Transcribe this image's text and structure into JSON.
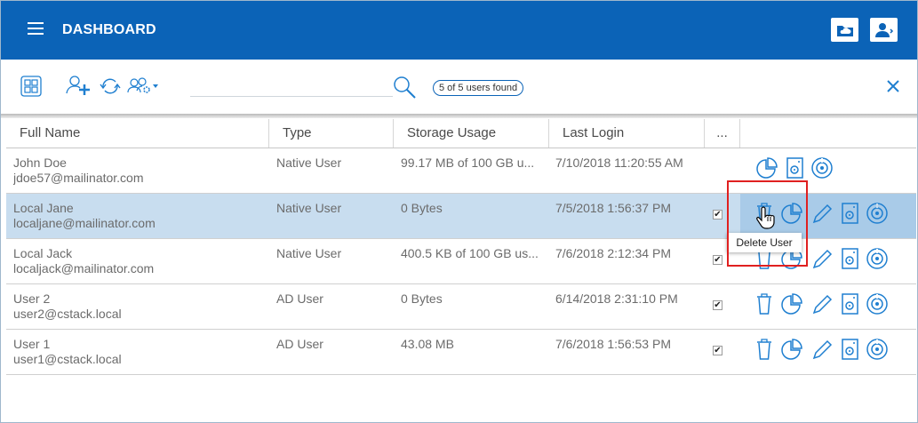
{
  "header": {
    "title": "DASHBOARD"
  },
  "toolbar": {
    "search_placeholder": "",
    "found_text": "5 of 5 users found"
  },
  "table": {
    "columns": [
      "Full Name",
      "Type",
      "Storage Usage",
      "Last Login",
      "..."
    ],
    "rows": [
      {
        "name": "John Doe",
        "email": "jdoe57@mailinator.com",
        "type": "Native User",
        "storage": "99.17 MB of 100 GB u...",
        "login": "7/10/2018 11:20:55 AM",
        "checked": false
      },
      {
        "name": "Local Jane",
        "email": "localjane@mailinator.com",
        "type": "Native User",
        "storage": "0 Bytes",
        "login": "7/5/2018 1:56:37 PM",
        "checked": true
      },
      {
        "name": "Local Jack",
        "email": "localjack@mailinator.com",
        "type": "Native User",
        "storage": "400.5 KB of 100 GB us...",
        "login": "7/6/2018 2:12:34 PM",
        "checked": true
      },
      {
        "name": "User 2",
        "email": "user2@cstack.local",
        "type": "AD User",
        "storage": "0 Bytes",
        "login": "6/14/2018 2:31:10 PM",
        "checked": true
      },
      {
        "name": "User 1",
        "email": "user1@cstack.local",
        "type": "AD User",
        "storage": "43.08 MB",
        "login": "7/6/2018 1:56:53 PM",
        "checked": true
      }
    ]
  },
  "tooltip": {
    "text": "Delete User"
  },
  "colors": {
    "brand": "#0b63b7",
    "selected_row": "#c8ddef",
    "highlight": "#e02020",
    "icon": "#1f7fd0"
  }
}
